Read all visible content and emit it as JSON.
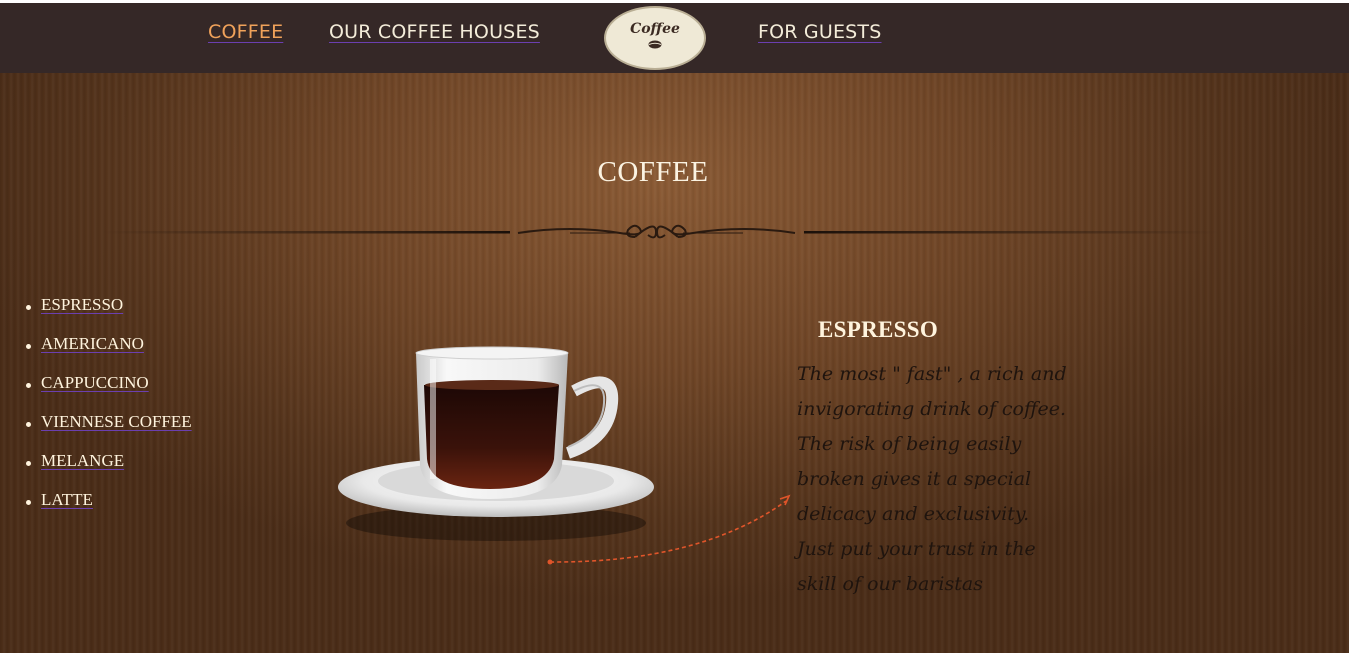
{
  "nav": {
    "coffee": "COFFEE",
    "houses": "OUR COFFEE HOUSES",
    "guests": "FOR GUESTS",
    "logo": "Coffee"
  },
  "section_title": "COFFEE",
  "menu": [
    "ESPRESSO",
    "AMERICANO",
    "CAPPUCCINO",
    "VIENNESE COFFEE",
    "MELANGE",
    "LATTE"
  ],
  "detail": {
    "title": "ESPRESSO",
    "text": "The most \" fast\" , a rich and invigorating drink of coffee. The risk of being easily broken gives it a special delicacy and exclusivity. Just put your trust in the skill of our baristas"
  },
  "colors": {
    "topbar": "#352827",
    "active_nav": "#f0a25a",
    "nav_text": "#f3ecd9",
    "link_underline": "#6b3fb0",
    "arrow": "#e0552a"
  },
  "icons": {
    "logo": "coffee-logo-badge",
    "divider": "ornamental-divider",
    "image": "espresso-cup-image",
    "arrow": "dashed-arrow"
  }
}
